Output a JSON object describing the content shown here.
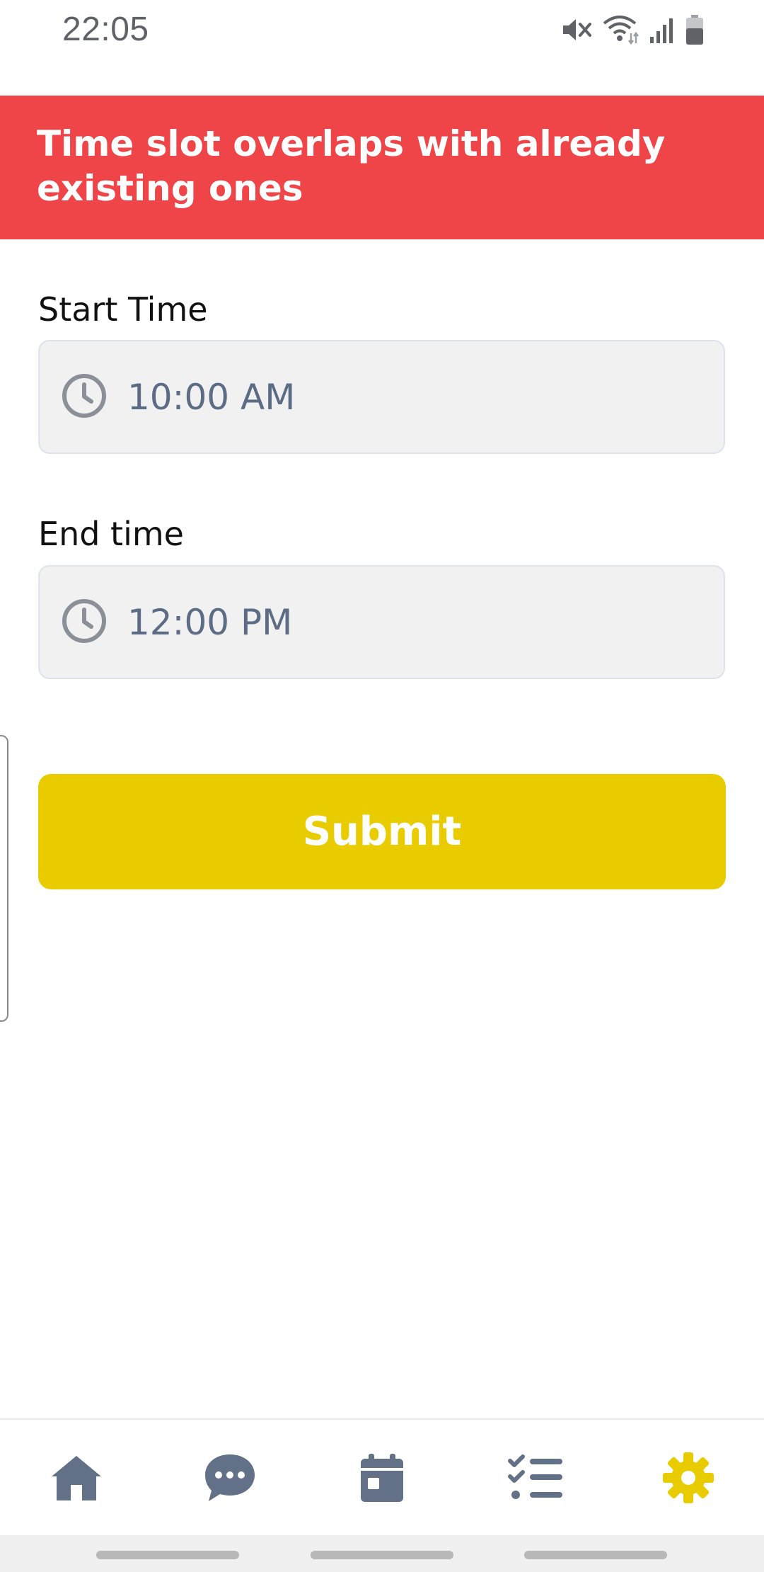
{
  "status_bar": {
    "time": "22:05",
    "icons": [
      "mute-icon",
      "wifi-icon",
      "signal-icon",
      "battery-icon"
    ]
  },
  "error_banner": {
    "message": "Time slot overlaps with already existing ones",
    "color": "#ef4548"
  },
  "form": {
    "start_time": {
      "label": "Start Time",
      "value": "10:00 AM",
      "icon": "clock-icon"
    },
    "end_time": {
      "label": "End time",
      "value": "12:00 PM",
      "icon": "clock-icon"
    },
    "submit_label": "Submit",
    "submit_color": "#e8cc00"
  },
  "bottom_nav": {
    "items": [
      {
        "icon": "home-icon",
        "active": false
      },
      {
        "icon": "chat-icon",
        "active": false
      },
      {
        "icon": "calendar-icon",
        "active": false
      },
      {
        "icon": "checklist-icon",
        "active": false
      },
      {
        "icon": "gear-icon",
        "active": true
      }
    ],
    "inactive_color": "#627088",
    "active_color": "#e8cc00"
  }
}
